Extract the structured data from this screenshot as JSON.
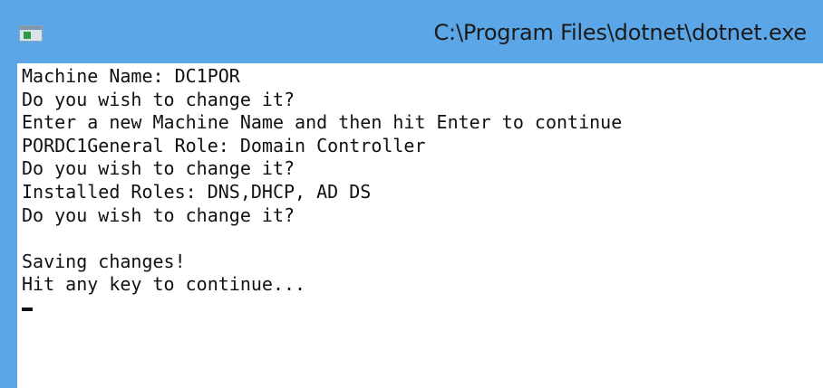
{
  "window": {
    "title": "C:\\Program Files\\dotnet\\dotnet.exe",
    "icon": "console-app-icon"
  },
  "console": {
    "lines": [
      "Machine Name: DC1POR",
      "Do you wish to change it?",
      "Enter a new Machine Name and then hit Enter to continue",
      "PORDC1General Role: Domain Controller",
      "Do you wish to change it?",
      "Installed Roles: DNS,DHCP, AD DS",
      "Do you wish to change it?",
      "",
      "Saving changes!",
      "Hit any key to continue..."
    ]
  },
  "colors": {
    "titlebar": "#5aa6e6",
    "console_background": "#ffffff",
    "console_text": "#111111"
  }
}
